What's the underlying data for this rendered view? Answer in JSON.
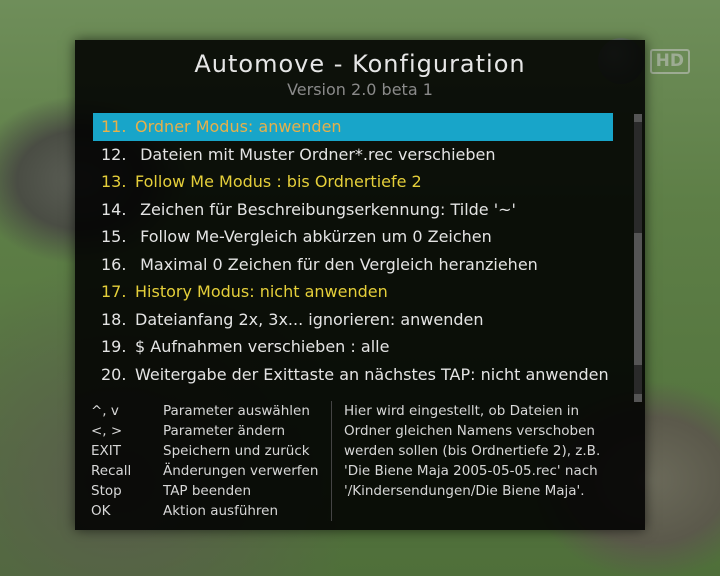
{
  "badge": {
    "hd": "HD"
  },
  "header": {
    "title": "Automove  -  Konfiguration",
    "subtitle": "Version 2.0 beta 1"
  },
  "list": [
    {
      "num": "11.",
      "label": "Ordner Modus: anwenden",
      "style": "sel"
    },
    {
      "num": "12.",
      "label": "  Dateien mit Muster Ordner*.rec verschieben",
      "style": "white"
    },
    {
      "num": "13.",
      "label": "Follow Me Modus : bis Ordnertiefe 2",
      "style": "yellow"
    },
    {
      "num": "14.",
      "label": "  Zeichen für Beschreibungserkennung: Tilde '~'",
      "style": "white"
    },
    {
      "num": "15.",
      "label": "  Follow Me-Vergleich abkürzen um 0 Zeichen",
      "style": "white"
    },
    {
      "num": "16.",
      "label": "  Maximal 0 Zeichen für den Vergleich heranziehen",
      "style": "white"
    },
    {
      "num": "17.",
      "label": "History Modus: nicht anwenden",
      "style": "yellow"
    },
    {
      "num": "18.",
      "label": "Dateianfang 2x, 3x... ignorieren: anwenden",
      "style": "white"
    },
    {
      "num": "19.",
      "label": "$ Aufnahmen verschieben : alle",
      "style": "white"
    },
    {
      "num": "20.",
      "label": "Weitergabe der Exittaste an nächstes TAP: nicht anwenden",
      "style": "white"
    }
  ],
  "footer": {
    "keys": [
      "^, v",
      "<, >",
      "EXIT",
      "Recall",
      "Stop",
      "OK"
    ],
    "actions": [
      "Parameter auswählen",
      "Parameter ändern",
      "Speichern und zurück",
      "Änderungen verwerfen",
      "TAP beenden",
      "Aktion ausführen"
    ],
    "desc": "Hier wird eingestellt, ob Dateien in Ordner gleichen Namens verschoben werden sollen (bis Ordnertiefe 2), z.B. 'Die Biene Maja 2005-05-05.rec' nach '/Kindersendungen/Die Biene Maja'."
  }
}
